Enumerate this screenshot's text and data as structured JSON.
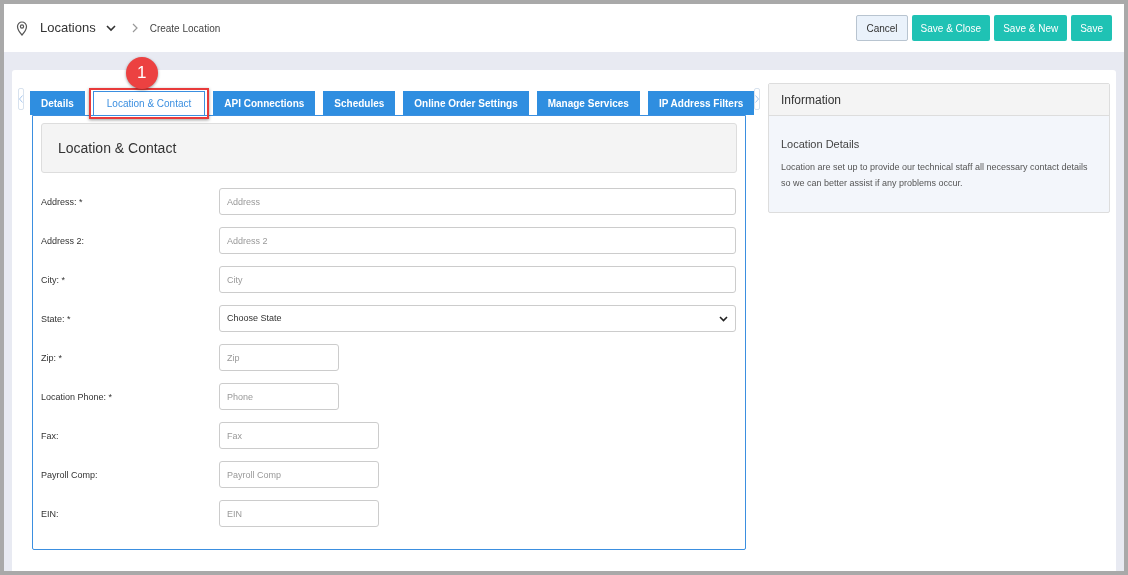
{
  "header": {
    "title": "Locations",
    "breadcrumb": "Create Location",
    "buttons": [
      {
        "label": "Cancel",
        "kind": "secondary"
      },
      {
        "label": "Save & Close",
        "kind": "primary"
      },
      {
        "label": "Save & New",
        "kind": "primary"
      },
      {
        "label": "Save",
        "kind": "primary"
      }
    ]
  },
  "tabs": [
    {
      "label": "Details",
      "selected": false
    },
    {
      "label": "Location & Contact",
      "selected": true,
      "annotation": "1"
    },
    {
      "label": "API Connections",
      "selected": false
    },
    {
      "label": "Schedules",
      "selected": false
    },
    {
      "label": "Online Order Settings",
      "selected": false
    },
    {
      "label": "Manage Services",
      "selected": false
    },
    {
      "label": "IP Address Filters",
      "selected": false
    }
  ],
  "section": {
    "title": "Location & Contact"
  },
  "fields": [
    {
      "label": "Address: *",
      "kind": "text",
      "placeholder": "Address"
    },
    {
      "label": "Address 2:",
      "kind": "text",
      "placeholder": "Address 2"
    },
    {
      "label": "City: *",
      "kind": "text",
      "placeholder": "City"
    },
    {
      "label": "State: *",
      "kind": "select",
      "value": "Choose State"
    },
    {
      "label": "Zip: *",
      "kind": "text",
      "placeholder": "Zip"
    },
    {
      "label": "Location Phone: *",
      "kind": "text",
      "placeholder": "Phone"
    },
    {
      "label": "Fax:",
      "kind": "text",
      "placeholder": "Fax"
    },
    {
      "label": "Payroll Comp:",
      "kind": "text",
      "placeholder": "Payroll Comp"
    },
    {
      "label": "EIN:",
      "kind": "text",
      "placeholder": "EIN"
    }
  ],
  "info": {
    "title": "Information",
    "subtitle": "Location Details",
    "text": "Location are set up to provide our technical staff all necessary contact details so we can better assist if any problems occur."
  }
}
